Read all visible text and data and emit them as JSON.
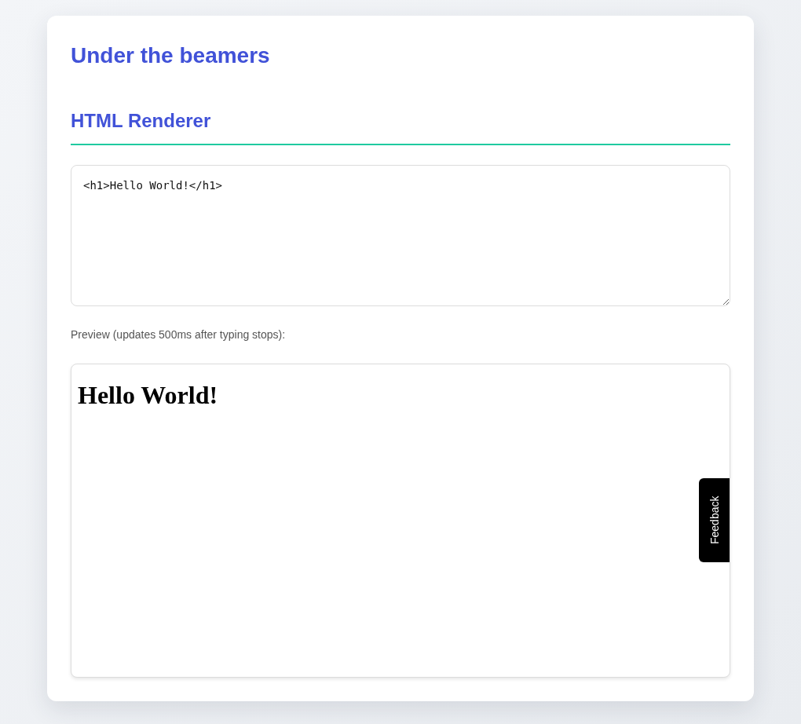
{
  "page": {
    "title": "Under the beamers"
  },
  "section": {
    "heading": "HTML Renderer"
  },
  "editor": {
    "value": "<h1>Hello World!</h1>"
  },
  "preview": {
    "label": "Preview (updates 500ms after typing stops):",
    "heading": "Hello World!"
  },
  "feedback_tab": {
    "label": "Feedback"
  }
}
